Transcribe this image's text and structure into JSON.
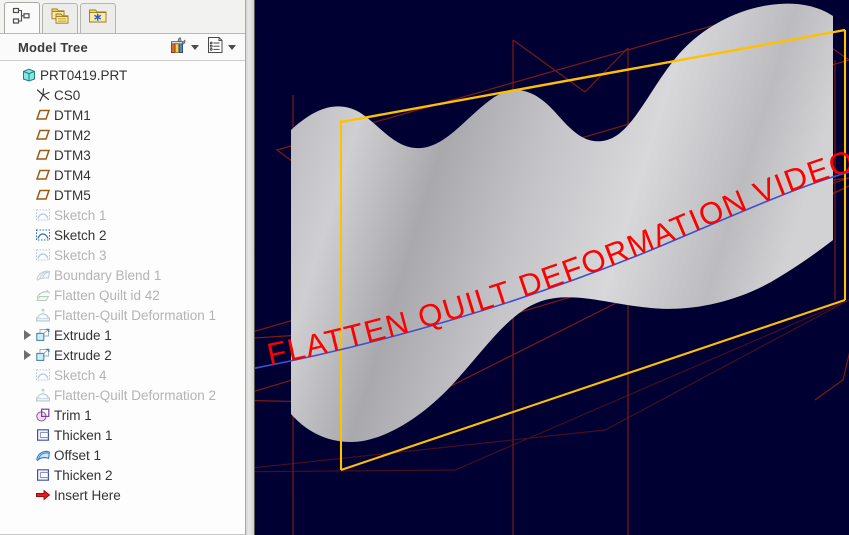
{
  "window": {
    "viewport_background": "#000033",
    "panel_background": "#fafafa"
  },
  "tabs": [
    {
      "name": "model-tree-tab",
      "icon": "hierarchy-icon",
      "title": "Model Tree",
      "active": true
    },
    {
      "name": "folder-browser-tab",
      "icon": "folders-icon",
      "title": "Folder Browser",
      "active": false
    },
    {
      "name": "favorites-tab",
      "icon": "folder-star-icon",
      "title": "Favorites",
      "active": false
    }
  ],
  "tree_header": {
    "title": "Model Tree",
    "settings_icon": "tools-icon",
    "display_icon": "list-settings-icon",
    "settings_caret": "chevron-down-icon",
    "display_caret": "chevron-down-icon"
  },
  "tree": {
    "items": [
      {
        "label": "PRT0419.PRT",
        "icon": "part-icon",
        "indent": 0,
        "dim": false,
        "twisty": false
      },
      {
        "label": "CS0",
        "icon": "csys-icon",
        "indent": 1,
        "dim": false,
        "twisty": false
      },
      {
        "label": "DTM1",
        "icon": "datum-plane-icon",
        "indent": 1,
        "dim": false,
        "twisty": false
      },
      {
        "label": "DTM2",
        "icon": "datum-plane-icon",
        "indent": 1,
        "dim": false,
        "twisty": false
      },
      {
        "label": "DTM3",
        "icon": "datum-plane-icon",
        "indent": 1,
        "dim": false,
        "twisty": false
      },
      {
        "label": "DTM4",
        "icon": "datum-plane-icon",
        "indent": 1,
        "dim": false,
        "twisty": false
      },
      {
        "label": "DTM5",
        "icon": "datum-plane-icon",
        "indent": 1,
        "dim": false,
        "twisty": false
      },
      {
        "label": "Sketch 1",
        "icon": "sketch-icon",
        "indent": 1,
        "dim": true,
        "twisty": false
      },
      {
        "label": "Sketch 2",
        "icon": "sketch-icon",
        "indent": 1,
        "dim": false,
        "twisty": false
      },
      {
        "label": "Sketch 3",
        "icon": "sketch-icon",
        "indent": 1,
        "dim": true,
        "twisty": false
      },
      {
        "label": "Boundary Blend 1",
        "icon": "boundary-blend-icon",
        "indent": 1,
        "dim": true,
        "twisty": false
      },
      {
        "label": "Flatten Quilt id 42",
        "icon": "flatten-quilt-icon",
        "indent": 1,
        "dim": true,
        "twisty": false
      },
      {
        "label": "Flatten-Quilt Deformation 1",
        "icon": "deformation-icon",
        "indent": 1,
        "dim": true,
        "twisty": false
      },
      {
        "label": "Extrude 1",
        "icon": "extrude-icon",
        "indent": 1,
        "dim": false,
        "twisty": true
      },
      {
        "label": "Extrude 2",
        "icon": "extrude-icon",
        "indent": 1,
        "dim": false,
        "twisty": true
      },
      {
        "label": "Sketch 4",
        "icon": "sketch-icon",
        "indent": 1,
        "dim": true,
        "twisty": false
      },
      {
        "label": "Flatten-Quilt Deformation 2",
        "icon": "deformation-icon",
        "indent": 1,
        "dim": true,
        "twisty": false
      },
      {
        "label": "Trim 1",
        "icon": "trim-icon",
        "indent": 1,
        "dim": false,
        "twisty": false
      },
      {
        "label": "Thicken 1",
        "icon": "thicken-icon",
        "indent": 1,
        "dim": false,
        "twisty": false
      },
      {
        "label": "Offset 1",
        "icon": "offset-icon",
        "indent": 1,
        "dim": false,
        "twisty": false
      },
      {
        "label": "Thicken 2",
        "icon": "thicken-icon",
        "indent": 1,
        "dim": false,
        "twisty": false
      },
      {
        "label": "Insert Here",
        "icon": "insert-here-icon",
        "indent": 1,
        "dim": false,
        "twisty": false
      }
    ]
  },
  "viewport": {
    "overlay_text": "FLATTEN  QUILT  DEFORMATION   VIDEO",
    "overlay_text_color": "#ff0000",
    "datum_color": "#7d1a14",
    "highlight_edge_color": "#ffc000",
    "curve_color": "#4050c8",
    "surface_light": "#dcdcdc",
    "surface_dark": "#a8a8ac"
  }
}
